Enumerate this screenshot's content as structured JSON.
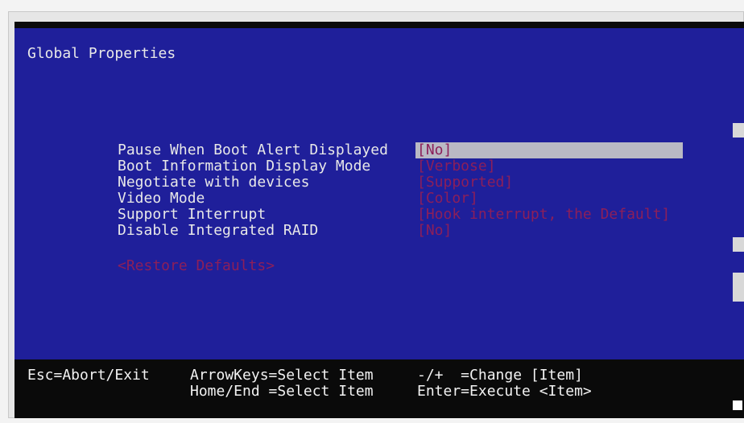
{
  "header": {
    "title": "Global Properties"
  },
  "settings": [
    {
      "label": "Pause When Boot Alert Displayed",
      "value": "[No]"
    },
    {
      "label": "Boot Information Display Mode",
      "value": "[Verbose]"
    },
    {
      "label": "Negotiate with devices",
      "value": "[Supported]"
    },
    {
      "label": "Video Mode",
      "value": "[Color]"
    },
    {
      "label": "Support Interrupt",
      "value": "[Hook interrupt, the Default]"
    },
    {
      "label": "Disable Integrated RAID",
      "value": "[No]"
    }
  ],
  "actions": {
    "restore_defaults": "<Restore Defaults>"
  },
  "footer": {
    "esc": "Esc=Abort/Exit",
    "arrow_keys": "ArrowKeys=Select Item",
    "home_end": "Home/End =Select Item",
    "change": "-/+  =Change [Item]",
    "enter": "Enter=Execute <Item>"
  },
  "colors": {
    "background_blue": "#1f1f9a",
    "selected_bar": "#b9b9c4",
    "value_text": "#8c1f5a",
    "label_text": "#e8e8e8"
  }
}
